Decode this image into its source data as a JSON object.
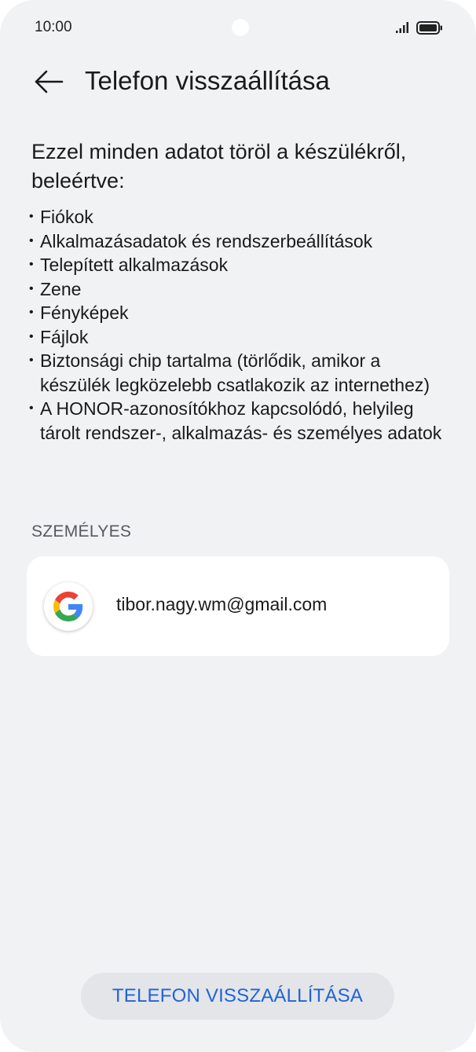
{
  "status_bar": {
    "time": "10:00"
  },
  "header": {
    "title": "Telefon visszaállítása",
    "back_icon": "arrow-left-icon"
  },
  "description": {
    "intro": "Ezzel minden adatot töröl a készülékről, beleértve:",
    "items": [
      "Fiókok",
      "Alkalmazásadatok és rendszerbeállítások",
      "Telepített alkalmazások",
      "Zene",
      "Fényképek",
      "Fájlok",
      "Biztonsági chip tartalma (törlődik, amikor a készülék legközelebb csatlakozik az internethez)",
      "A HONOR-azonosítókhoz kapcsolódó, helyileg tárolt rendszer-, alkalmazás- és személyes adatok"
    ]
  },
  "personal_section": {
    "heading": "SZEMÉLYES",
    "account": {
      "email": "tibor.nagy.wm@gmail.com",
      "icon": "google-logo-icon"
    }
  },
  "reset_button": {
    "label": "TELEFON VISSZAÁLLÍTÁSA"
  },
  "colors": {
    "background": "#f1f2f4",
    "card": "#ffffff",
    "accent": "#2163d6",
    "button_bg": "#e3e5e9"
  }
}
